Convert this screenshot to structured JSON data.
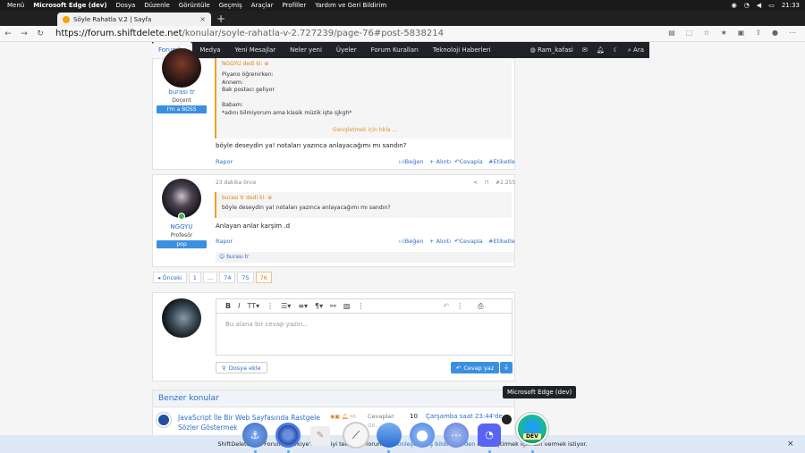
{
  "system": {
    "menu": "Menü",
    "app": "Microsoft Edge (dev)",
    "menus": [
      "Dosya",
      "Düzenle",
      "Görüntüle",
      "Geçmiş",
      "Araçlar",
      "Profiller",
      "Yardım ve Geri Bildirim"
    ],
    "clock": "21:33"
  },
  "browser": {
    "tab_title": "Söyle Rahatla V.2 | Sayfa",
    "url_host": "https://forum.shiftdelete.net",
    "url_path": "/konular/soyle-rahatla-v-2.727239/page-76#post-5838214"
  },
  "sitenav": {
    "items": [
      "Forumlar",
      "Medya",
      "Yeni Mesajlar",
      "Neler yeni",
      "Üyeler",
      "Forum Kuralları",
      "Teknoloji Haberleri"
    ],
    "user": "Ram_kafasi",
    "search": "Ara"
  },
  "post1": {
    "user": "burası tr",
    "title": "Doçent",
    "badge": "I'm a BOSS",
    "quote_head": "NGGYU dedi ki:",
    "quote_lines": [
      "Piyano öğrenirken:",
      "Annem:",
      "Bak postacı geliyor",
      "",
      "Babam:",
      "*adını bilmiyorum ama klasik müzik işte sjkgh*"
    ],
    "expand": "Genişletmek için tıkla ...",
    "text": "böyle deseydin ya! notaları yazınca anlayacağımı mı sandın?",
    "report": "Rapor",
    "like": "Beğen",
    "quote": "+ Alıntı",
    "reply": "Cevapla",
    "tag": "#Etiketle"
  },
  "post2": {
    "user": "NGGYU",
    "title": "Profesör",
    "badge": "pop",
    "time": "23 dakika önce",
    "number": "#2,255",
    "quote_head": "burası tr dedi ki:",
    "quote_text": "böyle deseydin ya! notaları yazınca anlayacağımı mı sandın?",
    "text": "Anlayan anlar karşim .d",
    "report": "Rapor",
    "like": "Beğen",
    "quote": "+ Alıntı",
    "reply": "Cevapla",
    "tag": "#Etiketle",
    "reaction": "burası tr"
  },
  "pager": {
    "prev": "◂ Önceki",
    "pages": [
      "1",
      "...",
      "74",
      "75",
      "76"
    ]
  },
  "reply": {
    "placeholder": "Bu alana bir cevap yazın...",
    "attach": "Dosya ekle",
    "submit": "Cevap yaz"
  },
  "similar": {
    "header": "Benzer konular",
    "thread_title": "JavaScript İle Bir Web Sayfasında Rastgele Sözler Göstermek",
    "replies_label": "Cevaplar:",
    "replies": "10",
    "views_label": "Gö...",
    "date": "Çarşamba saat 23:44'de"
  },
  "tooltip": "Microsoft Edge (dev)",
  "cookie": {
    "text1": "ShiftDelete.Net Forum - Türkiye'nin en iyi teknoloji forumu, ",
    "link": "etkinleştirilmiş bildirimlerden",
    "text2": " etkinleştirmek için izin vermek istiyor.",
    "close": "×"
  },
  "dock": {
    "dev_label": "DEV"
  },
  "colors": {
    "accent": "#2a6fc9",
    "nav": "#1f2328",
    "quote": "#f0a020"
  }
}
